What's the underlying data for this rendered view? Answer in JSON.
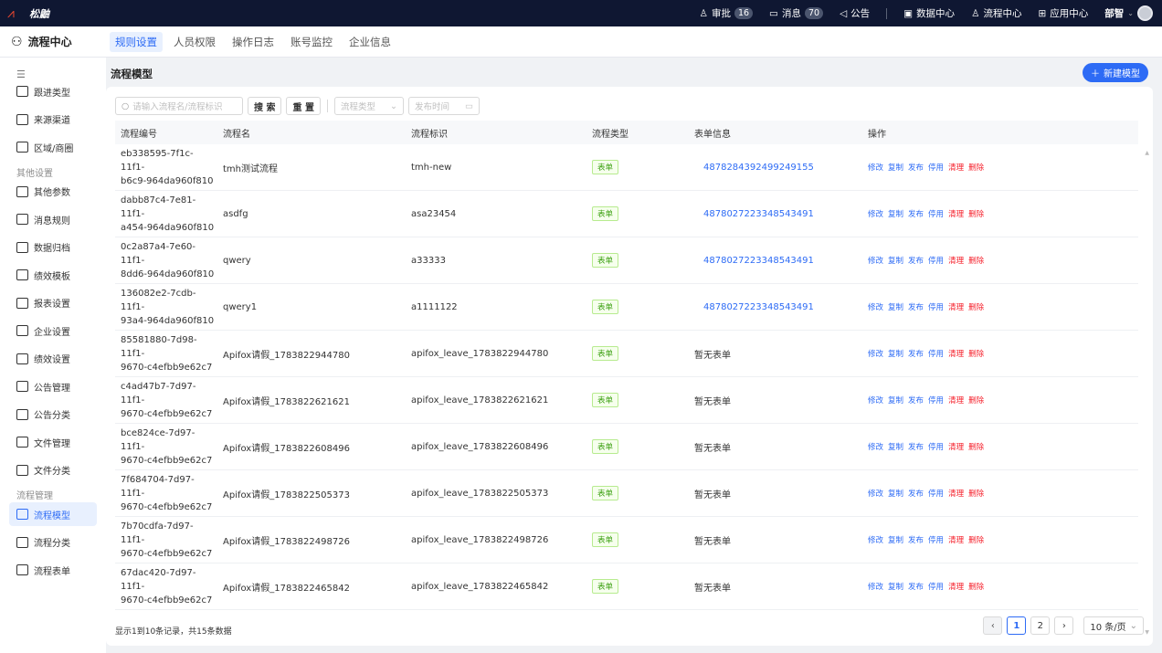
{
  "topbar": {
    "brand": "松鼬",
    "approve_label": "审批",
    "approve_count": "16",
    "message_label": "消息",
    "message_count": "70",
    "notice_label": "公告",
    "data_center": "数据中心",
    "flow_center": "流程中心",
    "app_center": "应用中心",
    "user": "部智"
  },
  "subbar": {
    "title": "流程中心",
    "tabs": [
      "规则设置",
      "人员权限",
      "操作日志",
      "账号监控",
      "企业信息"
    ]
  },
  "sidebar": {
    "items_top": [
      "跟进类型",
      "来源渠道",
      "区域/商圈"
    ],
    "group1": "其他设置",
    "items_other": [
      "其他参数",
      "消息规则",
      "数据归档",
      "绩效模板",
      "报表设置",
      "企业设置",
      "绩效设置",
      "公告管理",
      "公告分类",
      "文件管理",
      "文件分类"
    ],
    "group2": "流程管理",
    "items_flow": [
      "流程模型",
      "流程分类",
      "流程表单"
    ]
  },
  "page": {
    "title": "流程模型",
    "new_button": "新建模型"
  },
  "filters": {
    "search_placeholder": "请输入流程名/流程标识",
    "search_btn": "搜 索",
    "reset_btn": "重 置",
    "type_placeholder": "流程类型",
    "time_placeholder": "发布时间"
  },
  "table": {
    "headers": [
      "流程编号",
      "流程名",
      "流程标识",
      "流程类型",
      "表单信息",
      "操作"
    ],
    "actions": [
      "修改",
      "复制",
      "发布",
      "停用",
      "清理",
      "删除"
    ],
    "rows": [
      {
        "id1": "eb338595-7f1c-11f1-",
        "id2": "b6c9-964da960f810",
        "name": "tmh测试流程",
        "key": "tmh-new",
        "type": "表单",
        "form": "4878284392499249155",
        "has_form": true
      },
      {
        "id1": "dabb87c4-7e81-11f1-",
        "id2": "a454-964da960f810",
        "name": "asdfg",
        "key": "asa23454",
        "type": "表单",
        "form": "4878027223348543491",
        "has_form": true
      },
      {
        "id1": "0c2a87a4-7e60-11f1-",
        "id2": "8dd6-964da960f810",
        "name": "qwery",
        "key": "a33333",
        "type": "表单",
        "form": "4878027223348543491",
        "has_form": true
      },
      {
        "id1": "136082e2-7cdb-11f1-",
        "id2": "93a4-964da960f810",
        "name": "qwery1",
        "key": "a1111122",
        "type": "表单",
        "form": "4878027223348543491",
        "has_form": true
      },
      {
        "id1": "85581880-7d98-11f1-",
        "id2": "9670-c4efbb9e62c7",
        "name": "Apifox请假_1783822944780",
        "key": "apifox_leave_1783822944780",
        "type": "表单",
        "form": "暂无表单",
        "has_form": false
      },
      {
        "id1": "c4ad47b7-7d97-11f1-",
        "id2": "9670-c4efbb9e62c7",
        "name": "Apifox请假_1783822621621",
        "key": "apifox_leave_1783822621621",
        "type": "表单",
        "form": "暂无表单",
        "has_form": false
      },
      {
        "id1": "bce824ce-7d97-11f1-",
        "id2": "9670-c4efbb9e62c7",
        "name": "Apifox请假_1783822608496",
        "key": "apifox_leave_1783822608496",
        "type": "表单",
        "form": "暂无表单",
        "has_form": false
      },
      {
        "id1": "7f684704-7d97-11f1-",
        "id2": "9670-c4efbb9e62c7",
        "name": "Apifox请假_1783822505373",
        "key": "apifox_leave_1783822505373",
        "type": "表单",
        "form": "暂无表单",
        "has_form": false
      },
      {
        "id1": "7b70cdfa-7d97-11f1-",
        "id2": "9670-c4efbb9e62c7",
        "name": "Apifox请假_1783822498726",
        "key": "apifox_leave_1783822498726",
        "type": "表单",
        "form": "暂无表单",
        "has_form": false
      },
      {
        "id1": "67dac420-7d97-11f1-",
        "id2": "9670-c4efbb9e62c7",
        "name": "Apifox请假_1783822465842",
        "key": "apifox_leave_1783822465842",
        "type": "表单",
        "form": "暂无表单",
        "has_form": false
      }
    ]
  },
  "footer": {
    "summary": "显示1到10条记录，共15条数据",
    "pages": [
      "1",
      "2"
    ],
    "page_size": "10 条/页"
  },
  "colors": {
    "accent": "#2d6bf5",
    "topbar": "#0f1732",
    "danger": "#f5222d",
    "tag_green": "#389e0d"
  }
}
